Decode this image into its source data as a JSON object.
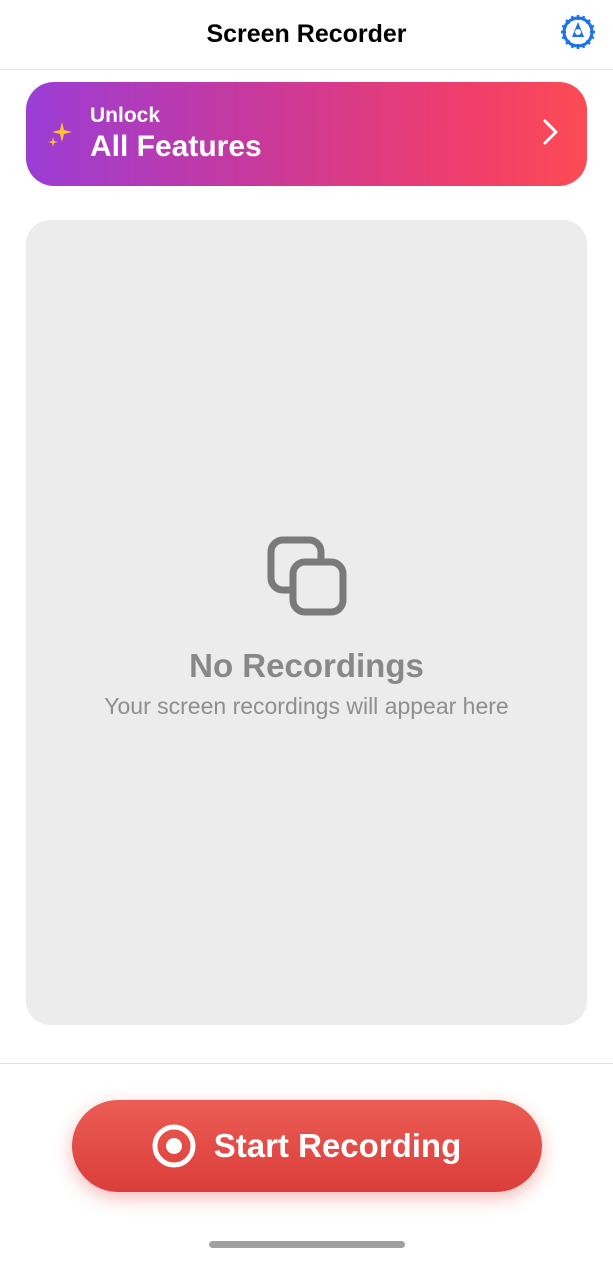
{
  "header": {
    "title": "Screen Recorder"
  },
  "unlockBanner": {
    "label": "Unlock",
    "title": "All Features"
  },
  "emptyState": {
    "title": "No Recordings",
    "subtitle": "Your screen recordings will appear here"
  },
  "startButton": {
    "label": "Start Recording"
  }
}
